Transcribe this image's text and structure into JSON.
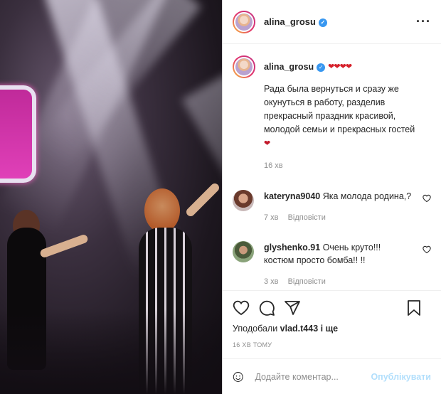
{
  "header": {
    "username": "alina_grosu",
    "more_icon": "more-horizontal-icon"
  },
  "caption": {
    "username": "alina_grosu",
    "hearts": "❤❤❤❤",
    "text": "Рада была вернуться и сразу же окунуться в работу, разделив прекрасный праздник красивой, молодой семьи и прекрасных гостей",
    "emoji": "❤",
    "time": "16 хв"
  },
  "comments": [
    {
      "username": "kateryna9040",
      "text": "Яка молода родина,?",
      "time": "7 хв",
      "reply": "Відповісти"
    },
    {
      "username": "glyshenko.91",
      "text": "Очень круто!!! костюм просто бомба!! !!",
      "time": "3 хв",
      "reply": "Відповісти"
    }
  ],
  "actions": {
    "liked_by_prefix": "Уподобали",
    "liked_by_user": "vlad.t443",
    "liked_by_suffix": "і ще",
    "posted_time": "16 хв тому"
  },
  "add_comment": {
    "placeholder": "Додайте коментар...",
    "publish_label": "Опублікувати"
  },
  "colors": {
    "verified": "#3897f0",
    "publish_disabled": "#b2dffc",
    "heart": "#d6202a"
  }
}
